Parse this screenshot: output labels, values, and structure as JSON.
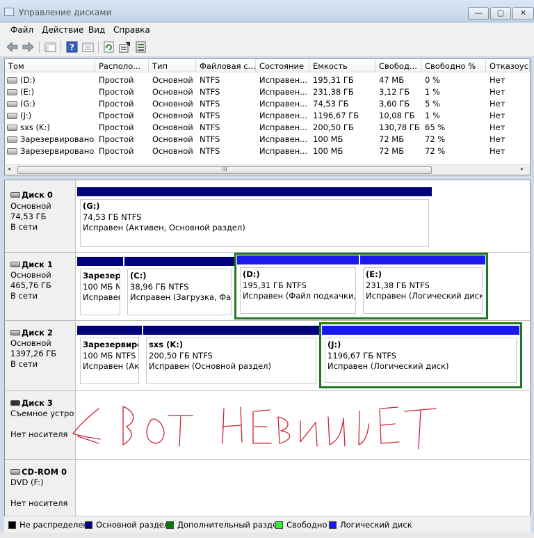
{
  "window": {
    "title": "Управление дисками",
    "min": "—",
    "max": "▢",
    "close": "✕"
  },
  "menu": [
    "Файл",
    "Действие",
    "Вид",
    "Справка"
  ],
  "toolbar": [
    "back-icon",
    "forward-icon",
    "console-tree-icon",
    "help-icon",
    "properties-list-icon",
    "refresh-icon",
    "properties-icon",
    "disk-settings-icon"
  ],
  "volume_list": {
    "columns": [
      "Том",
      "Располо...",
      "Тип",
      "Файловая с...",
      "Состояние",
      "Емкость",
      "Свобод...",
      "Свободно %",
      "Отказоус"
    ],
    "rows": [
      [
        "(D:)",
        "Простой",
        "Основной",
        "NTFS",
        "Исправен...",
        "195,31 ГБ",
        "47 МБ",
        "0 %",
        "Нет"
      ],
      [
        "(E:)",
        "Простой",
        "Основной",
        "NTFS",
        "Исправен...",
        "231,38 ГБ",
        "3,12 ГБ",
        "1 %",
        "Нет"
      ],
      [
        "(G:)",
        "Простой",
        "Основной",
        "NTFS",
        "Исправен...",
        "74,53 ГБ",
        "3,60 ГБ",
        "5 %",
        "Нет"
      ],
      [
        "(J:)",
        "Простой",
        "Основной",
        "NTFS",
        "Исправен...",
        "1196,67 ГБ",
        "10,08 ГБ",
        "1 %",
        "Нет"
      ],
      [
        "sxs (K:)",
        "Простой",
        "Основной",
        "NTFS",
        "Исправен...",
        "200,50 ГБ",
        "130,78 ГБ",
        "65 %",
        "Нет"
      ],
      [
        "Зарезервировано...",
        "Простой",
        "Основной",
        "NTFS",
        "Исправен...",
        "100 МБ",
        "72 МБ",
        "72 %",
        "Нет"
      ],
      [
        "Зарезервировано...",
        "Простой",
        "Основной",
        "NTFS",
        "Исправен...",
        "100 МБ",
        "72 МБ",
        "72 %",
        "Нет"
      ]
    ],
    "scroll_grip": "III",
    "scroll_left": "◂",
    "scroll_right": "▸"
  },
  "disks": [
    {
      "name": "Диск 0",
      "type": "Основной",
      "size": "74,53 ГБ",
      "status": "В сети",
      "partitions": [
        {
          "title": "(G:)",
          "size": "74,53 ГБ NTFS",
          "status": "Исправен (Активен, Основной раздел)",
          "kind": "primary"
        }
      ]
    },
    {
      "name": "Диск 1",
      "type": "Основной",
      "size": "465,76 ГБ",
      "status": "В сети",
      "partitions": [
        {
          "title": "Зарезерв",
          "size": "100 МБ N",
          "status": "Исправен",
          "kind": "primary"
        },
        {
          "title": "(C:)",
          "size": "38,96 ГБ NTFS",
          "status": "Исправен (Загрузка, Файл",
          "kind": "primary"
        },
        {
          "title": "(D:)",
          "size": "195,31 ГБ NTFS",
          "status": "Исправен (Файл подкачки, Л",
          "kind": "logical"
        },
        {
          "title": "(E:)",
          "size": "231,38 ГБ NTFS",
          "status": "Исправен (Логический диск)",
          "kind": "logical"
        }
      ]
    },
    {
      "name": "Диск 2",
      "type": "Основной",
      "size": "1397,26 ГБ",
      "status": "В сети",
      "partitions": [
        {
          "title": "Зарезервиров",
          "size": "100 МБ NTFS",
          "status": "Исправен (Акт",
          "kind": "primary"
        },
        {
          "title": "sxs  (K:)",
          "size": "200,50 ГБ NTFS",
          "status": "Исправен (Основной раздел)",
          "kind": "primary"
        },
        {
          "title": "(J:)",
          "size": "1196,67 ГБ NTFS",
          "status": "Исправен (Логический диск)",
          "kind": "logical"
        }
      ]
    },
    {
      "name": "Диск 3",
      "type": "Съемное устро",
      "status": "Нет носителя"
    },
    {
      "name": "CD-ROM 0",
      "type": "DVD (F:)",
      "status": "Нет носителя"
    }
  ],
  "legend": [
    {
      "label": "Не распределен",
      "color": "#000000"
    },
    {
      "label": "Основной раздел",
      "color": "#000080"
    },
    {
      "label": "Дополнительный раздел",
      "color": "#008000"
    },
    {
      "label": "Свободно",
      "color": "#33ee33"
    },
    {
      "label": "Логический диск",
      "color": "#1a1aee"
    }
  ],
  "colors": {
    "primary": "#00007a",
    "logical": "#1a1aee",
    "selection": "#1f7a1f",
    "scribble": "#cc2233"
  }
}
